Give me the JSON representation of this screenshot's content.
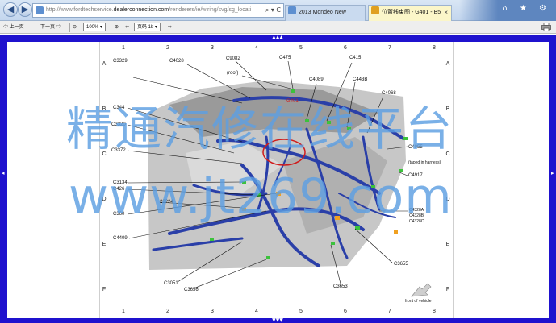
{
  "browser": {
    "url_prefix": "http://www.fordtechservice.",
    "url_domain": "dealerconnection.com",
    "url_suffix": "/renderers/ie/wiring/svg/sg_locati",
    "address_controls": "⌕ ▾ C",
    "tabs": [
      {
        "label": "2013 Mondeo New"
      },
      {
        "label": "位置线束图 - G401 - B5",
        "close": "×"
      }
    ],
    "window_icons": "⌂ ★ ⚙"
  },
  "toolbar": {
    "prev_label": "上一页",
    "next_label": "下一页",
    "zoom_value": "100%",
    "page_value": "页码 1b",
    "icons": [
      "back-arrow-icon",
      "forward-arrow-icon",
      "zoom-out-icon",
      "zoom-in-icon",
      "print-icon"
    ]
  },
  "sheet": {
    "columns": [
      "1",
      "2",
      "3",
      "4",
      "5",
      "6",
      "7",
      "8"
    ],
    "rows": [
      "A",
      "B",
      "C",
      "D",
      "E",
      "F"
    ],
    "top_indicator": "▲▲▲",
    "bottom_indicator": "▼▼▼"
  },
  "diagram": {
    "labels": [
      {
        "id": "c3329",
        "text": "C3329"
      },
      {
        "id": "c4028",
        "text": "C4028"
      },
      {
        "id": "c9082",
        "text": "C9082"
      },
      {
        "id": "c475",
        "text": "C475"
      },
      {
        "id": "c415",
        "text": "C415"
      },
      {
        "id": "roof",
        "text": "(roof)"
      },
      {
        "id": "c4089",
        "text": "C4089"
      },
      {
        "id": "c443b",
        "text": "C443B"
      },
      {
        "id": "g401",
        "text": "G401",
        "color": "#d01c1c"
      },
      {
        "id": "c4068",
        "text": "C4068"
      },
      {
        "id": "c344",
        "text": "C344"
      },
      {
        "id": "c3320",
        "text": "C3320"
      },
      {
        "id": "c3372",
        "text": "C3372"
      },
      {
        "id": "c4055",
        "text": "C4055"
      },
      {
        "id": "taped",
        "text": "(taped in harness)"
      },
      {
        "id": "c4917",
        "text": "C4917"
      },
      {
        "id": "c3134",
        "text": "C3134"
      },
      {
        "id": "c426",
        "text": "C426"
      },
      {
        "id": "c2828",
        "text": "28224"
      },
      {
        "id": "c360",
        "text": "C360"
      },
      {
        "id": "c4328a",
        "text": "C4328A"
      },
      {
        "id": "c4328b",
        "text": "C4328B"
      },
      {
        "id": "c4328c",
        "text": "C4328C"
      },
      {
        "id": "c4409",
        "text": "C4409"
      },
      {
        "id": "c3655",
        "text": "C3655"
      },
      {
        "id": "c3051",
        "text": "C3051"
      },
      {
        "id": "c3656",
        "text": "C3656"
      },
      {
        "id": "c3653",
        "text": "C3653"
      },
      {
        "id": "front",
        "text": "front of vehicle"
      }
    ]
  },
  "watermark": {
    "line1": "精通汽修在线平台",
    "line2": "www.jt269.com"
  },
  "colors": {
    "viewport_bg": "#1f12ce",
    "harness": "#2a3fa8",
    "connector": "#3cc23c",
    "highlight_circle": "#d01c1c",
    "watermark": "#5d9fe2"
  }
}
